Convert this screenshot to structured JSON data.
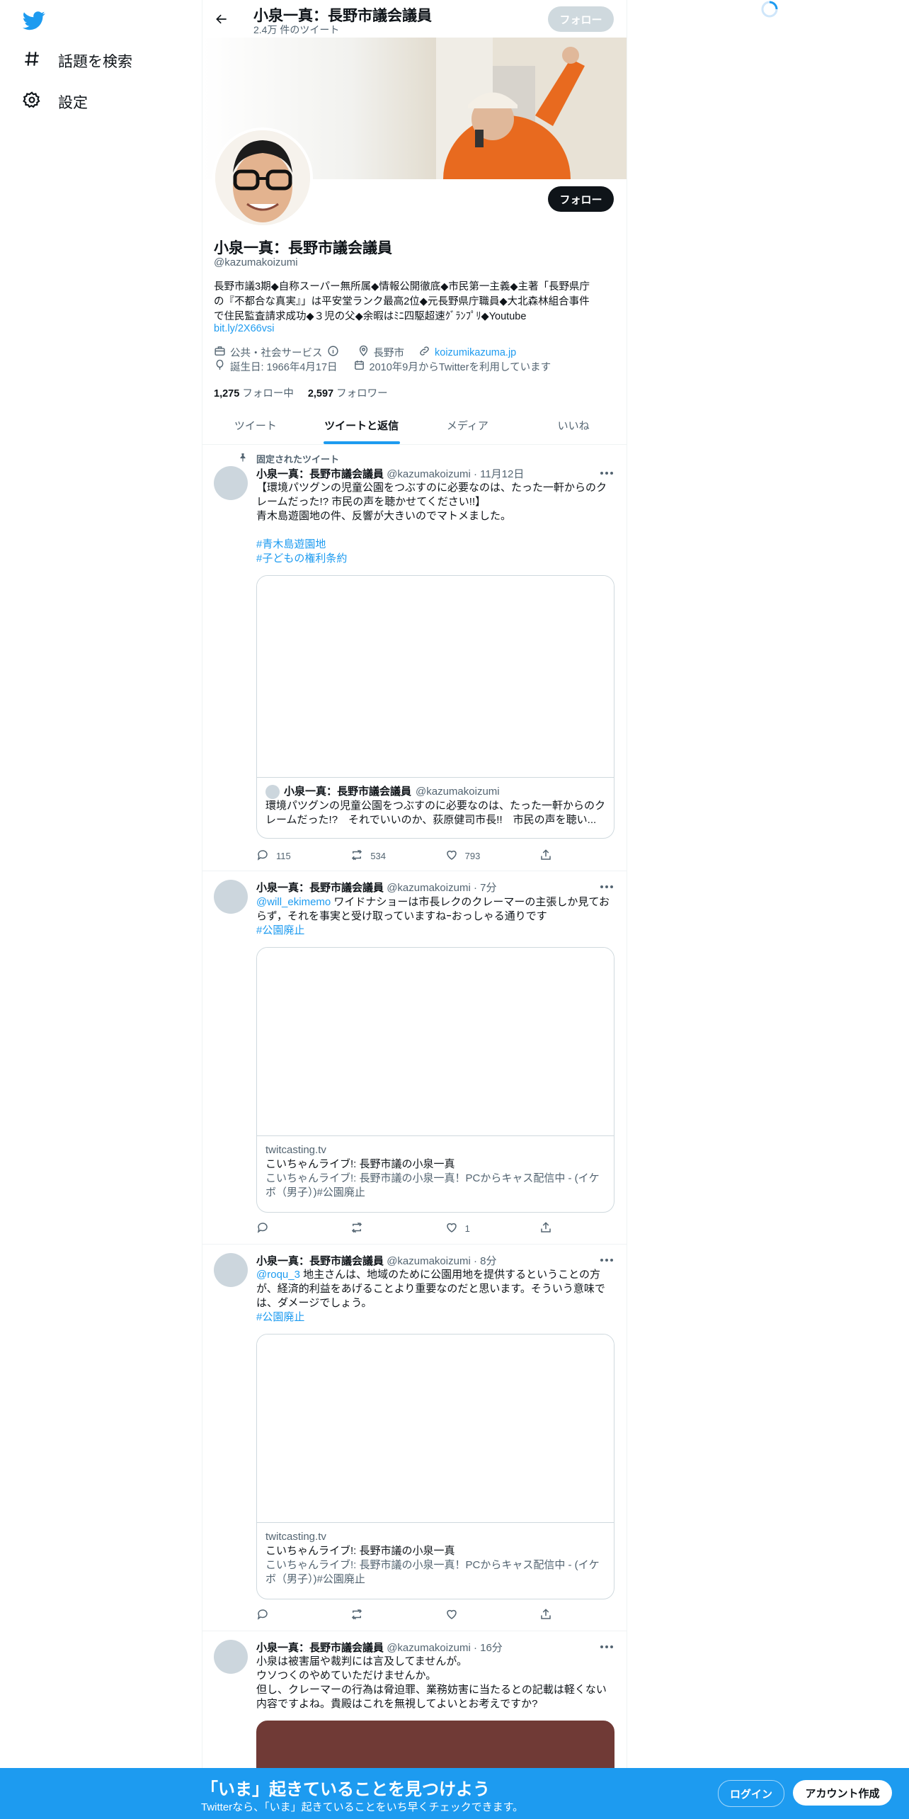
{
  "nav": {
    "explore_label": "話題を検索",
    "settings_label": "設定"
  },
  "header": {
    "title": "小泉一真：長野市議会議員",
    "tweet_count": "2.4万 件のツイート",
    "follow_label": "フォロー"
  },
  "profile": {
    "name": "小泉一真：長野市議会議員",
    "handle": "@kazumakoizumi",
    "follow_label": "フォロー",
    "bio_line1": "長野市議3期◆自称スーパー無所属◆情報公開徹底◆市民第一主義◆主著「長野県庁",
    "bio_line2": "の『不都合な真実』」は平安堂ランク最高2位◆元長野県庁職員◆大北森林組合事件",
    "bio_line3": "で住民監査請求成功◆３児の父◆余暇はﾐﾆ四駆超速ｸﾞﾗﾝﾌﾟﾘ◆Youtube",
    "bio_link": "bit.ly/2X66vsi",
    "category": "公共・社会サービス",
    "location": "長野市",
    "website": "koizumikazuma.jp",
    "birthday": "誕生日: 1966年4月17日",
    "joined": "2010年9月からTwitterを利用しています",
    "following_count": "1,275",
    "following_label": "フォロー中",
    "followers_count": "2,597",
    "followers_label": "フォロワー"
  },
  "tabs": [
    "ツイート",
    "ツイートと返信",
    "メディア",
    "いいね"
  ],
  "tweets": [
    {
      "pinned_label": "固定されたツイート",
      "name": "小泉一真：長野市議会議員",
      "meta": "@kazumakoizumi · 11月12日",
      "text_line1": "【環境パツグンの児童公園をつぶすのに必要なのは、たった一軒からのク",
      "text_line2": "レームだった!? 市民の声を聴かせてください!!】",
      "text_line3": "青木島遊園地の件、反響が大きいのでマトメました。",
      "hashtag1": "#青木島遊園地",
      "hashtag2": "#子どもの権利条約",
      "quote_name": "小泉一真：長野市議会議員",
      "quote_handle": "@kazumakoizumi",
      "quote_line1": "環境パツグンの児童公園をつぶすのに必要なのは、たった一軒からのク",
      "quote_line2": "レームだった!?　それでいいのか、荻原健司市長!!　市民の声を聴い...",
      "replies": "115",
      "retweets": "534",
      "likes": "793"
    },
    {
      "name": "小泉一真：長野市議会議員",
      "meta": "@kazumakoizumi · 7分",
      "mention": "@will_ekimemo",
      "text_line1": " ワイドナショーは市長レクのクレーマーの主張しか見てお",
      "text_line2": "らず，それを事実と受け取っていますねｰおっしゃる通りです",
      "hashtag": "#公園廃止",
      "card_domain": "twitcasting.tv",
      "card_title": "こいちゃんライブ!: 長野市議の小泉一真",
      "card_desc1": "こいちゃんライブ!: 長野市議の小泉一真！PCからキャス配信中 - (イケ",
      "card_desc2": "ボ（男子）)#公園廃止",
      "likes": "1"
    },
    {
      "name": "小泉一真：長野市議会議員",
      "meta": "@kazumakoizumi · 8分",
      "mention": "@roqu_3",
      "text_line1": " 地主さんは、地域のために公園用地を提供するということの方",
      "text_line2": "が、経済的利益をあげることより重要なのだと思います。そういう意味で",
      "text_line3": "は、ダメージでしょう。",
      "hashtag": "#公園廃止",
      "card_domain": "twitcasting.tv",
      "card_title": "こいちゃんライブ!: 長野市議の小泉一真",
      "card_desc1": "こいちゃんライブ!: 長野市議の小泉一真！PCからキャス配信中 - (イケ",
      "card_desc2": "ボ（男子）)#公園廃止"
    },
    {
      "name": "小泉一真：長野市議会議員",
      "meta": "@kazumakoizumi · 16分",
      "text_line1": "小泉は被害届や裁判には言及してませんが。",
      "text_line2": "ウソつくのやめていただけませんか。",
      "text_line3": "但し、クレーマーの行為は脅迫罪、業務妨害に当たるとの記載は軽くない",
      "text_line4": "内容ですよね。貴殿はこれを無視してよいとお考えですか?"
    }
  ],
  "bottom_bar": {
    "title": "「いま」起きていることを見つけよう",
    "subtitle": "Twitterなら、「いま」起きていることをいち早くチェックできます。",
    "login_label": "ログイン",
    "signup_label": "アカウント作成"
  },
  "colors": {
    "accent": "#1d9bf0",
    "text": "#0f1419",
    "muted": "#536471"
  }
}
